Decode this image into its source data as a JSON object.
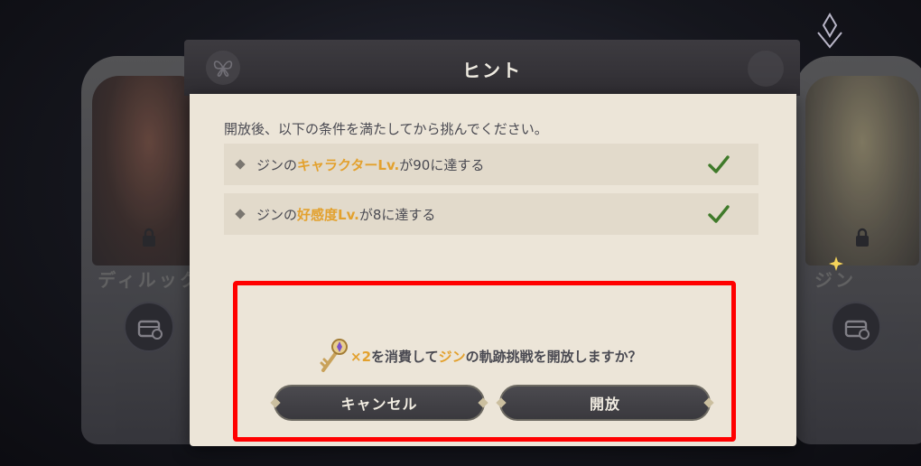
{
  "background": {
    "left_card_name": "ディルック",
    "right_card_name": "ジン"
  },
  "dialog": {
    "title": "ヒント",
    "intro": "開放後、以下の条件を満たしてから挑んでください。",
    "conditions": [
      {
        "prefix": "ジンの",
        "highlight": "キャラクターLv.",
        "suffix": "が90に達する",
        "status": "check-icon"
      },
      {
        "prefix": "ジンの",
        "highlight": "好感度Lv.",
        "suffix": "が8に達する",
        "status": "check-icon"
      }
    ],
    "confirm": {
      "cost": "×2",
      "text_a": "を消費して",
      "character": "ジン",
      "text_b": "の軌跡挑戦を開放しますか？"
    },
    "buttons": {
      "cancel": "キャンセル",
      "open": "開放"
    }
  },
  "colors": {
    "highlight_text": "#e3a12e",
    "annotation_box": "#ff0000",
    "dialog_body": "#ece5d8",
    "check": "#3f7a2a"
  }
}
